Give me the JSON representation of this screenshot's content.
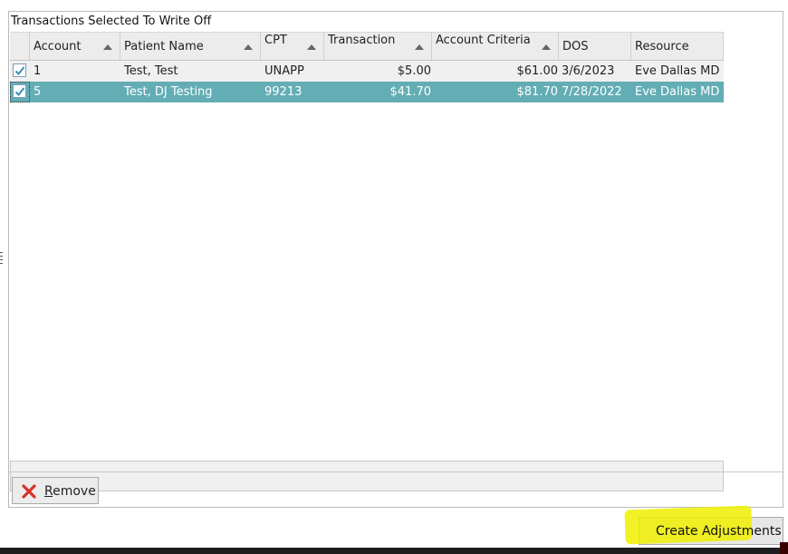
{
  "panel": {
    "title": "Transactions Selected To Write Off"
  },
  "grid": {
    "columns": [
      {
        "label": "Account"
      },
      {
        "label": "Patient Name"
      },
      {
        "label": "CPT"
      },
      {
        "label": "Transaction"
      },
      {
        "label": "Account Criteria"
      },
      {
        "label": "DOS"
      },
      {
        "label": "Resource"
      }
    ],
    "rows": [
      {
        "checked": true,
        "account": "1",
        "patient": "Test, Test",
        "cpt": "UNAPP",
        "transaction": "$5.00",
        "criteria": "$61.00",
        "dos": "3/6/2023",
        "resource": "Eve Dallas MD"
      },
      {
        "checked": true,
        "account": "5",
        "patient": "Test, DJ Testing",
        "cpt": "99213",
        "transaction": "$41.70",
        "criteria": "$81.70",
        "dos": "7/28/2022",
        "resource": "Eve Dallas MD"
      }
    ]
  },
  "buttons": {
    "remove_accel": "R",
    "remove_rest": "emove",
    "create": "Create Adjustments"
  },
  "colors": {
    "selected_row": "#63adb5",
    "highlight": "#eeee00",
    "remove_icon": "#d9302c"
  }
}
